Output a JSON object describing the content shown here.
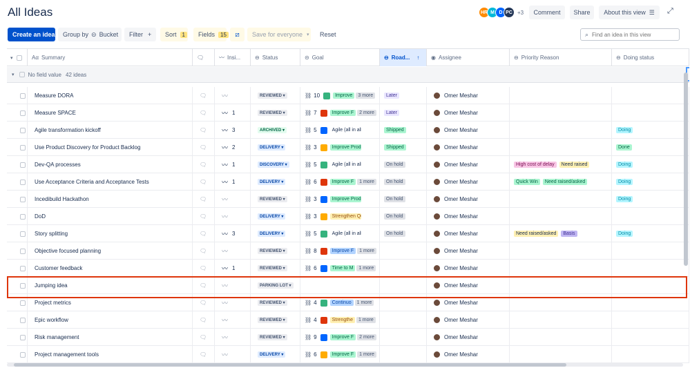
{
  "header": {
    "title": "All Ideas",
    "avatars": [
      {
        "initials": "HR",
        "color": "#ff8b00"
      },
      {
        "initials": "M",
        "color": "#00b8d9"
      },
      {
        "initials": "D",
        "color": "#0065ff"
      },
      {
        "initials": "PC",
        "color": "#253858"
      }
    ],
    "avatars_more": "+3",
    "comment_label": "Comment",
    "share_label": "Share",
    "about_label": "About this view"
  },
  "toolbar": {
    "create_label": "Create an idea",
    "group_by_label": "Group by",
    "group_by_value": "Bucket",
    "filter_label": "Filter",
    "sort_label": "Sort",
    "sort_count": "1",
    "fields_label": "Fields",
    "fields_count": "15",
    "save_label": "Save for everyone",
    "reset_label": "Reset",
    "search_placeholder": "Find an idea in this view"
  },
  "columns": {
    "summary": "Summary",
    "insights": "Insi...",
    "status": "Status",
    "goal": "Goal",
    "roadmap": "Road...",
    "assignee": "Assignee",
    "priority_reason": "Priority Reason",
    "doing_status": "Doing status"
  },
  "group": {
    "label": "No field value",
    "count": "42 ideas"
  },
  "rows": [
    {
      "summary": "Measure DORA",
      "insight": "",
      "status": "REVIEWED",
      "status_class": "st-reviewed",
      "goal_count": "10",
      "goal": "Improve",
      "goal_class": "goal-green",
      "goal_more": "3 more",
      "roadmap": "Later",
      "roadmap_class": "rb-later",
      "assignee": "Omer Meshar",
      "pr": [],
      "doing": "",
      "doing_class": ""
    },
    {
      "summary": "Measure SPACE",
      "insight": "1",
      "status": "REVIEWED",
      "status_class": "st-reviewed",
      "goal_count": "7",
      "goal": "Improve F",
      "goal_class": "goal-green",
      "goal_more": "2 more",
      "roadmap": "Later",
      "roadmap_class": "rb-later",
      "assignee": "Omer Meshar",
      "pr": [],
      "doing": "",
      "doing_class": ""
    },
    {
      "summary": "Agile transformation kickoff",
      "insight": "3",
      "status": "ARCHIVED",
      "status_class": "st-archived",
      "goal_count": "5",
      "goal": "Agile (all in all)",
      "goal_class": "goal-plain",
      "goal_more": "",
      "roadmap": "Shipped",
      "roadmap_class": "rb-shipped",
      "assignee": "Omer Meshar",
      "pr": [],
      "doing": "Doing",
      "doing_class": "ds-doing"
    },
    {
      "summary": "Use Product Discovery for Product Backlog",
      "insight": "2",
      "status": "DELIVERY",
      "status_class": "st-delivery",
      "goal_count": "3",
      "goal": "Improve Productivi",
      "goal_class": "goal-green",
      "goal_more": "",
      "roadmap": "Shipped",
      "roadmap_class": "rb-shipped",
      "assignee": "Omer Meshar",
      "pr": [],
      "doing": "Done",
      "doing_class": "ds-done"
    },
    {
      "summary": "Dev-QA processes",
      "insight": "1",
      "status": "DISCOVERY",
      "status_class": "st-discovery",
      "goal_count": "5",
      "goal": "Agile (all in all)",
      "goal_class": "goal-plain",
      "goal_more": "",
      "roadmap": "On hold",
      "roadmap_class": "rb-hold",
      "assignee": "Omer Meshar",
      "pr": [
        {
          "label": "High cost of delay",
          "cls": "pr-pink"
        },
        {
          "label": "Need raised",
          "cls": "pr-yellow"
        }
      ],
      "doing": "Doing",
      "doing_class": "ds-doing"
    },
    {
      "summary": "Use Acceptance Criteria and Acceptance Tests",
      "insight": "1",
      "status": "DELIVERY",
      "status_class": "st-delivery",
      "goal_count": "6",
      "goal": "Improve F",
      "goal_class": "goal-green",
      "goal_more": "1 more",
      "roadmap": "On hold",
      "roadmap_class": "rb-hold",
      "assignee": "Omer Meshar",
      "pr": [
        {
          "label": "Quick Win",
          "cls": "pr-green"
        },
        {
          "label": "Need raised/asked",
          "cls": "pr-green"
        }
      ],
      "doing": "Doing",
      "doing_class": "ds-doing"
    },
    {
      "summary": "Incedibuild Hackathon",
      "insight": "",
      "status": "REVIEWED",
      "status_class": "st-reviewed",
      "goal_count": "3",
      "goal": "Improve Productivi",
      "goal_class": "goal-green",
      "goal_more": "",
      "roadmap": "On hold",
      "roadmap_class": "rb-hold",
      "assignee": "Omer Meshar",
      "pr": [],
      "doing": "Doing",
      "doing_class": "ds-doing"
    },
    {
      "summary": "DoD",
      "insight": "",
      "status": "DELIVERY",
      "status_class": "st-delivery",
      "goal_count": "3",
      "goal": "Strengthen Quality",
      "goal_class": "goal-yellow",
      "goal_more": "",
      "roadmap": "On hold",
      "roadmap_class": "rb-hold",
      "assignee": "Omer Meshar",
      "pr": [],
      "doing": "",
      "doing_class": ""
    },
    {
      "summary": "Story splitting",
      "insight": "3",
      "status": "DELIVERY",
      "status_class": "st-delivery",
      "goal_count": "5",
      "goal": "Agile (all in all)",
      "goal_class": "goal-plain",
      "goal_more": "",
      "roadmap": "On hold",
      "roadmap_class": "rb-hold",
      "assignee": "Omer Meshar",
      "pr": [
        {
          "label": "Need raised/asked",
          "cls": "pr-yellow"
        },
        {
          "label": "Basis",
          "cls": "pr-purple"
        }
      ],
      "doing": "Doing",
      "doing_class": "ds-doing"
    },
    {
      "summary": "Objective focused planning",
      "insight": "",
      "status": "REVIEWED",
      "status_class": "st-reviewed",
      "goal_count": "8",
      "goal": "Improve F",
      "goal_class": "goal-blue",
      "goal_more": "1 more",
      "roadmap": "",
      "roadmap_class": "",
      "assignee": "Omer Meshar",
      "pr": [],
      "doing": "",
      "doing_class": ""
    },
    {
      "summary": "Customer feedback",
      "insight": "1",
      "status": "REVIEWED",
      "status_class": "st-reviewed",
      "goal_count": "6",
      "goal": "Time to M",
      "goal_class": "goal-green",
      "goal_more": "1 more",
      "roadmap": "",
      "roadmap_class": "",
      "assignee": "Omer Meshar",
      "pr": [],
      "doing": "",
      "doing_class": ""
    },
    {
      "summary": "Jumping idea",
      "insight": "",
      "status": "PARKING LOT",
      "status_class": "st-parking",
      "goal_count": "",
      "goal": "",
      "goal_class": "",
      "goal_more": "",
      "roadmap": "",
      "roadmap_class": "",
      "assignee": "Omer Meshar",
      "pr": [],
      "doing": "",
      "doing_class": ""
    },
    {
      "summary": "Project metrics",
      "insight": "",
      "status": "REVIEWED",
      "status_class": "st-reviewed",
      "goal_count": "4",
      "goal": "Continuo",
      "goal_class": "goal-blue",
      "goal_more": "1 more",
      "roadmap": "",
      "roadmap_class": "",
      "assignee": "Omer Meshar",
      "pr": [],
      "doing": "",
      "doing_class": ""
    },
    {
      "summary": "Epic workflow",
      "insight": "",
      "status": "REVIEWED",
      "status_class": "st-reviewed",
      "goal_count": "4",
      "goal": "Strengthe",
      "goal_class": "goal-yellow",
      "goal_more": "1 more",
      "roadmap": "",
      "roadmap_class": "",
      "assignee": "Omer Meshar",
      "pr": [],
      "doing": "",
      "doing_class": ""
    },
    {
      "summary": "Risk management",
      "insight": "",
      "status": "REVIEWED",
      "status_class": "st-reviewed",
      "goal_count": "9",
      "goal": "Improve F",
      "goal_class": "goal-green",
      "goal_more": "2 more",
      "roadmap": "",
      "roadmap_class": "",
      "assignee": "Omer Meshar",
      "pr": [],
      "doing": "",
      "doing_class": ""
    },
    {
      "summary": "Project management tools",
      "insight": "",
      "status": "DELIVERY",
      "status_class": "st-delivery",
      "goal_count": "6",
      "goal": "Improve F",
      "goal_class": "goal-green",
      "goal_more": "1 more",
      "roadmap": "",
      "roadmap_class": "",
      "assignee": "Omer Meshar",
      "pr": [],
      "doing": "",
      "doing_class": ""
    }
  ]
}
